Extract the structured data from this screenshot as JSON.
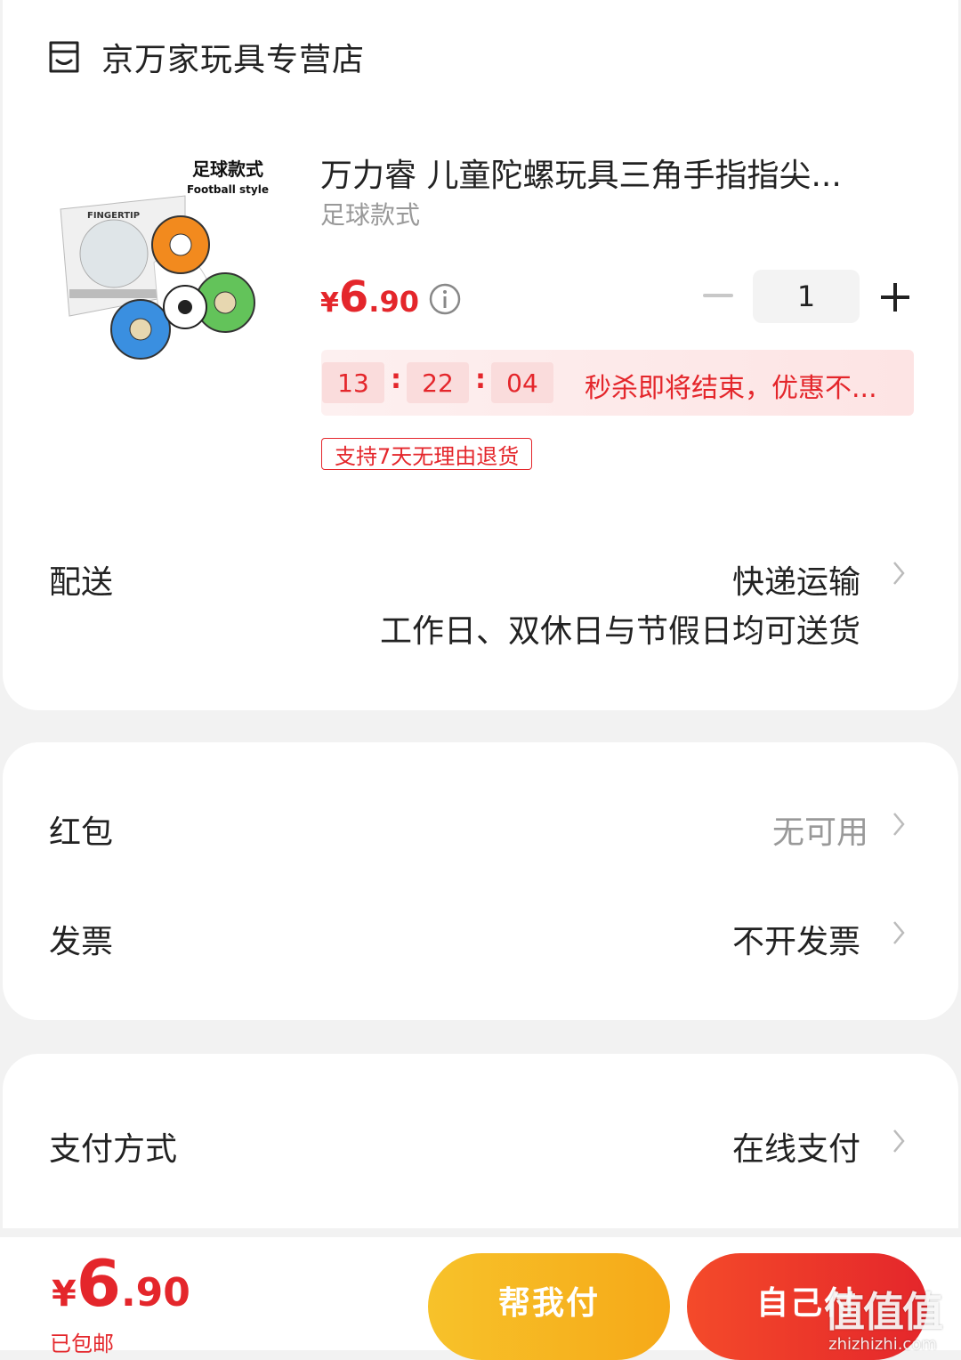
{
  "store": {
    "name": "京万家玩具专营店",
    "icon": "store-icon"
  },
  "product": {
    "image_caption_cn": "足球款式",
    "image_caption_en": "Football style",
    "image_box_text": "FINGERTIP",
    "title": "万力睿 儿童陀螺玩具三角手指指尖...",
    "variant": "足球款式",
    "price": {
      "currency": "¥",
      "integer": "6",
      "decimal": ".90"
    },
    "quantity": "1"
  },
  "countdown": {
    "hours": "13",
    "minutes": "22",
    "seconds": "04",
    "separator": ":",
    "message": "秒杀即将结束，优惠不..."
  },
  "return_badge": "支持7天无理由退货",
  "delivery": {
    "label": "配送",
    "method": "快递运输",
    "note": "工作日、双休日与节假日均可送货"
  },
  "red_packet": {
    "label": "红包",
    "value": "无可用"
  },
  "invoice": {
    "label": "发票",
    "value": "不开发票"
  },
  "payment": {
    "label": "支付方式",
    "value": "在线支付"
  },
  "footer": {
    "total": {
      "currency": "¥",
      "integer": "6",
      "decimal": ".90"
    },
    "shipping_note": "已包邮",
    "help_pay_label": "帮我付",
    "self_pay_label": "自己付"
  },
  "watermark": {
    "logo": "值值值",
    "url": "zhizhizhi.com"
  },
  "colors": {
    "accent": "#e4262b",
    "help_button": "#f7b820",
    "background": "#f2f2f2"
  }
}
